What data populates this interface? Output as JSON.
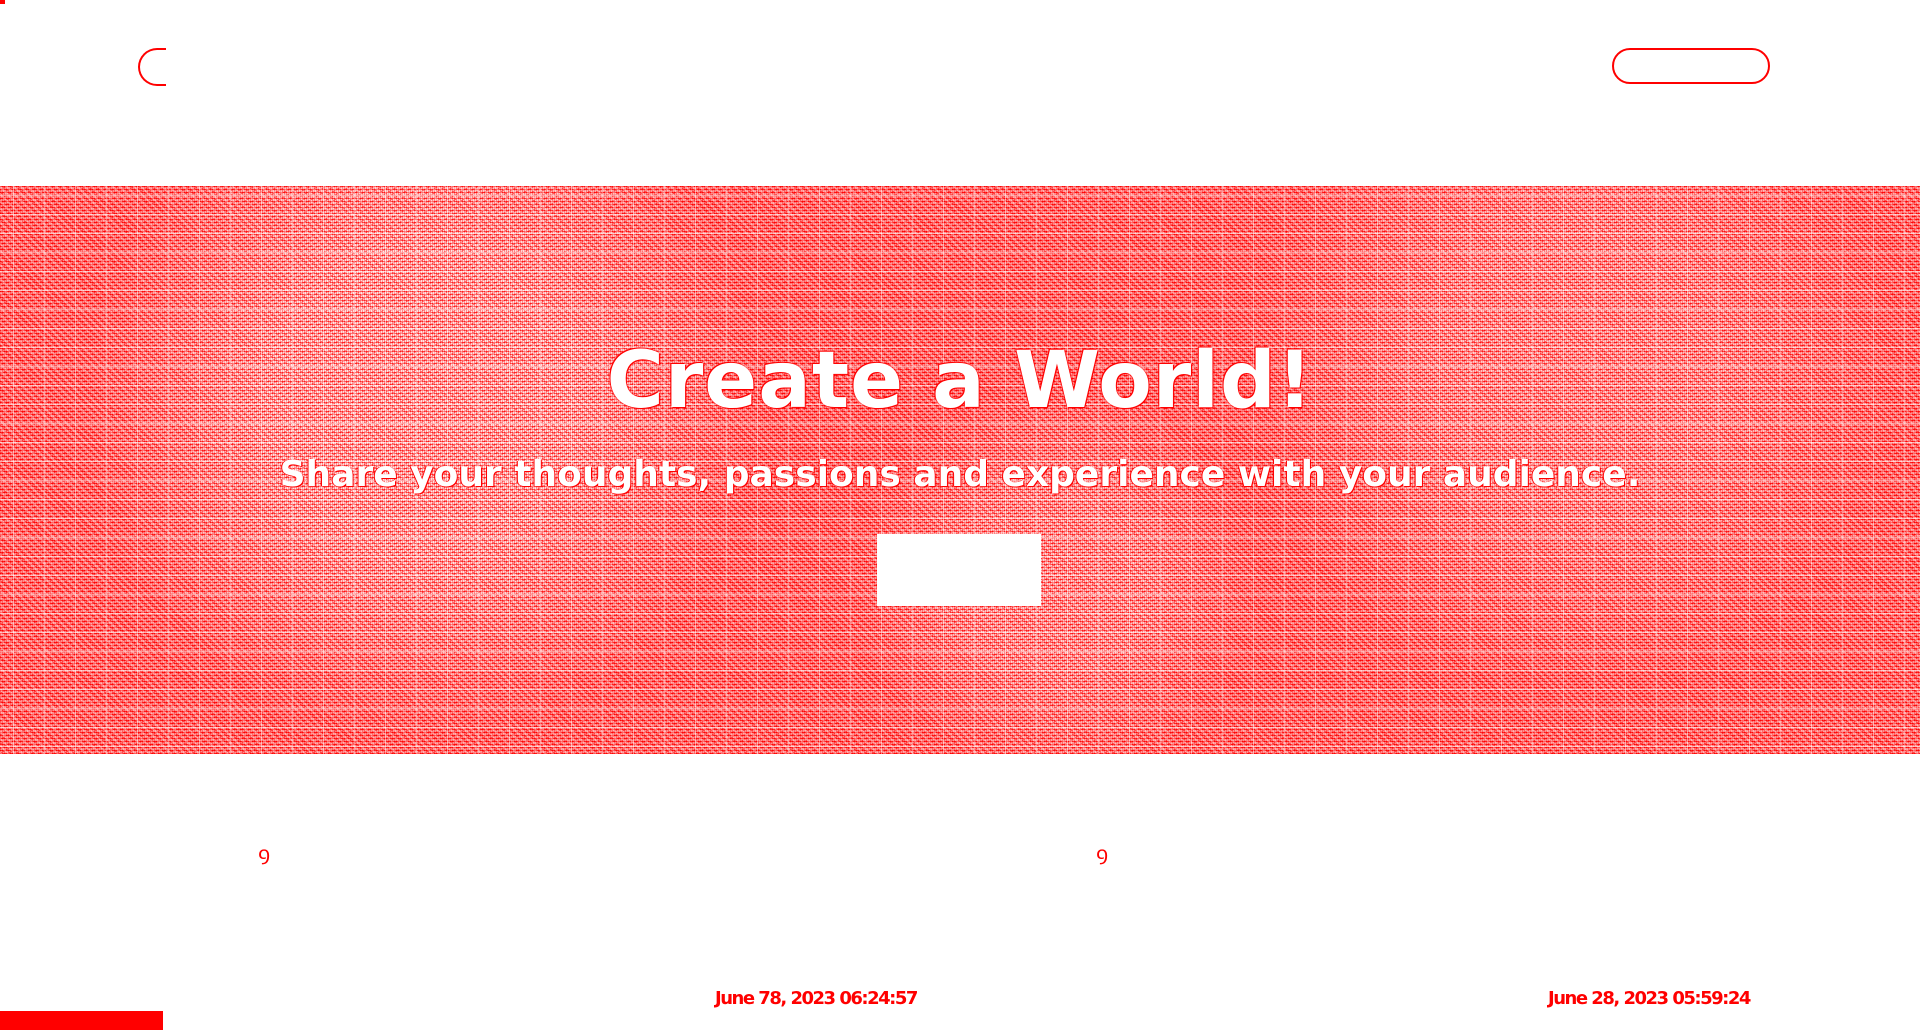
{
  "hero": {
    "title": "Create a World!",
    "subtitle": "Share your thoughts, passions and experience with your audience."
  },
  "icons": {
    "logo": "logo-icon",
    "card_icon": "bookmark-icon"
  },
  "cards": [
    {
      "icon_glyph": "ꝰ",
      "date": "June 78, 2023 06:24:57"
    },
    {
      "icon_glyph": "ꝰ",
      "date": "June 28, 2023 05:59:24"
    }
  ],
  "colors": {
    "accent": "#ff0000",
    "background": "#ffffff"
  }
}
